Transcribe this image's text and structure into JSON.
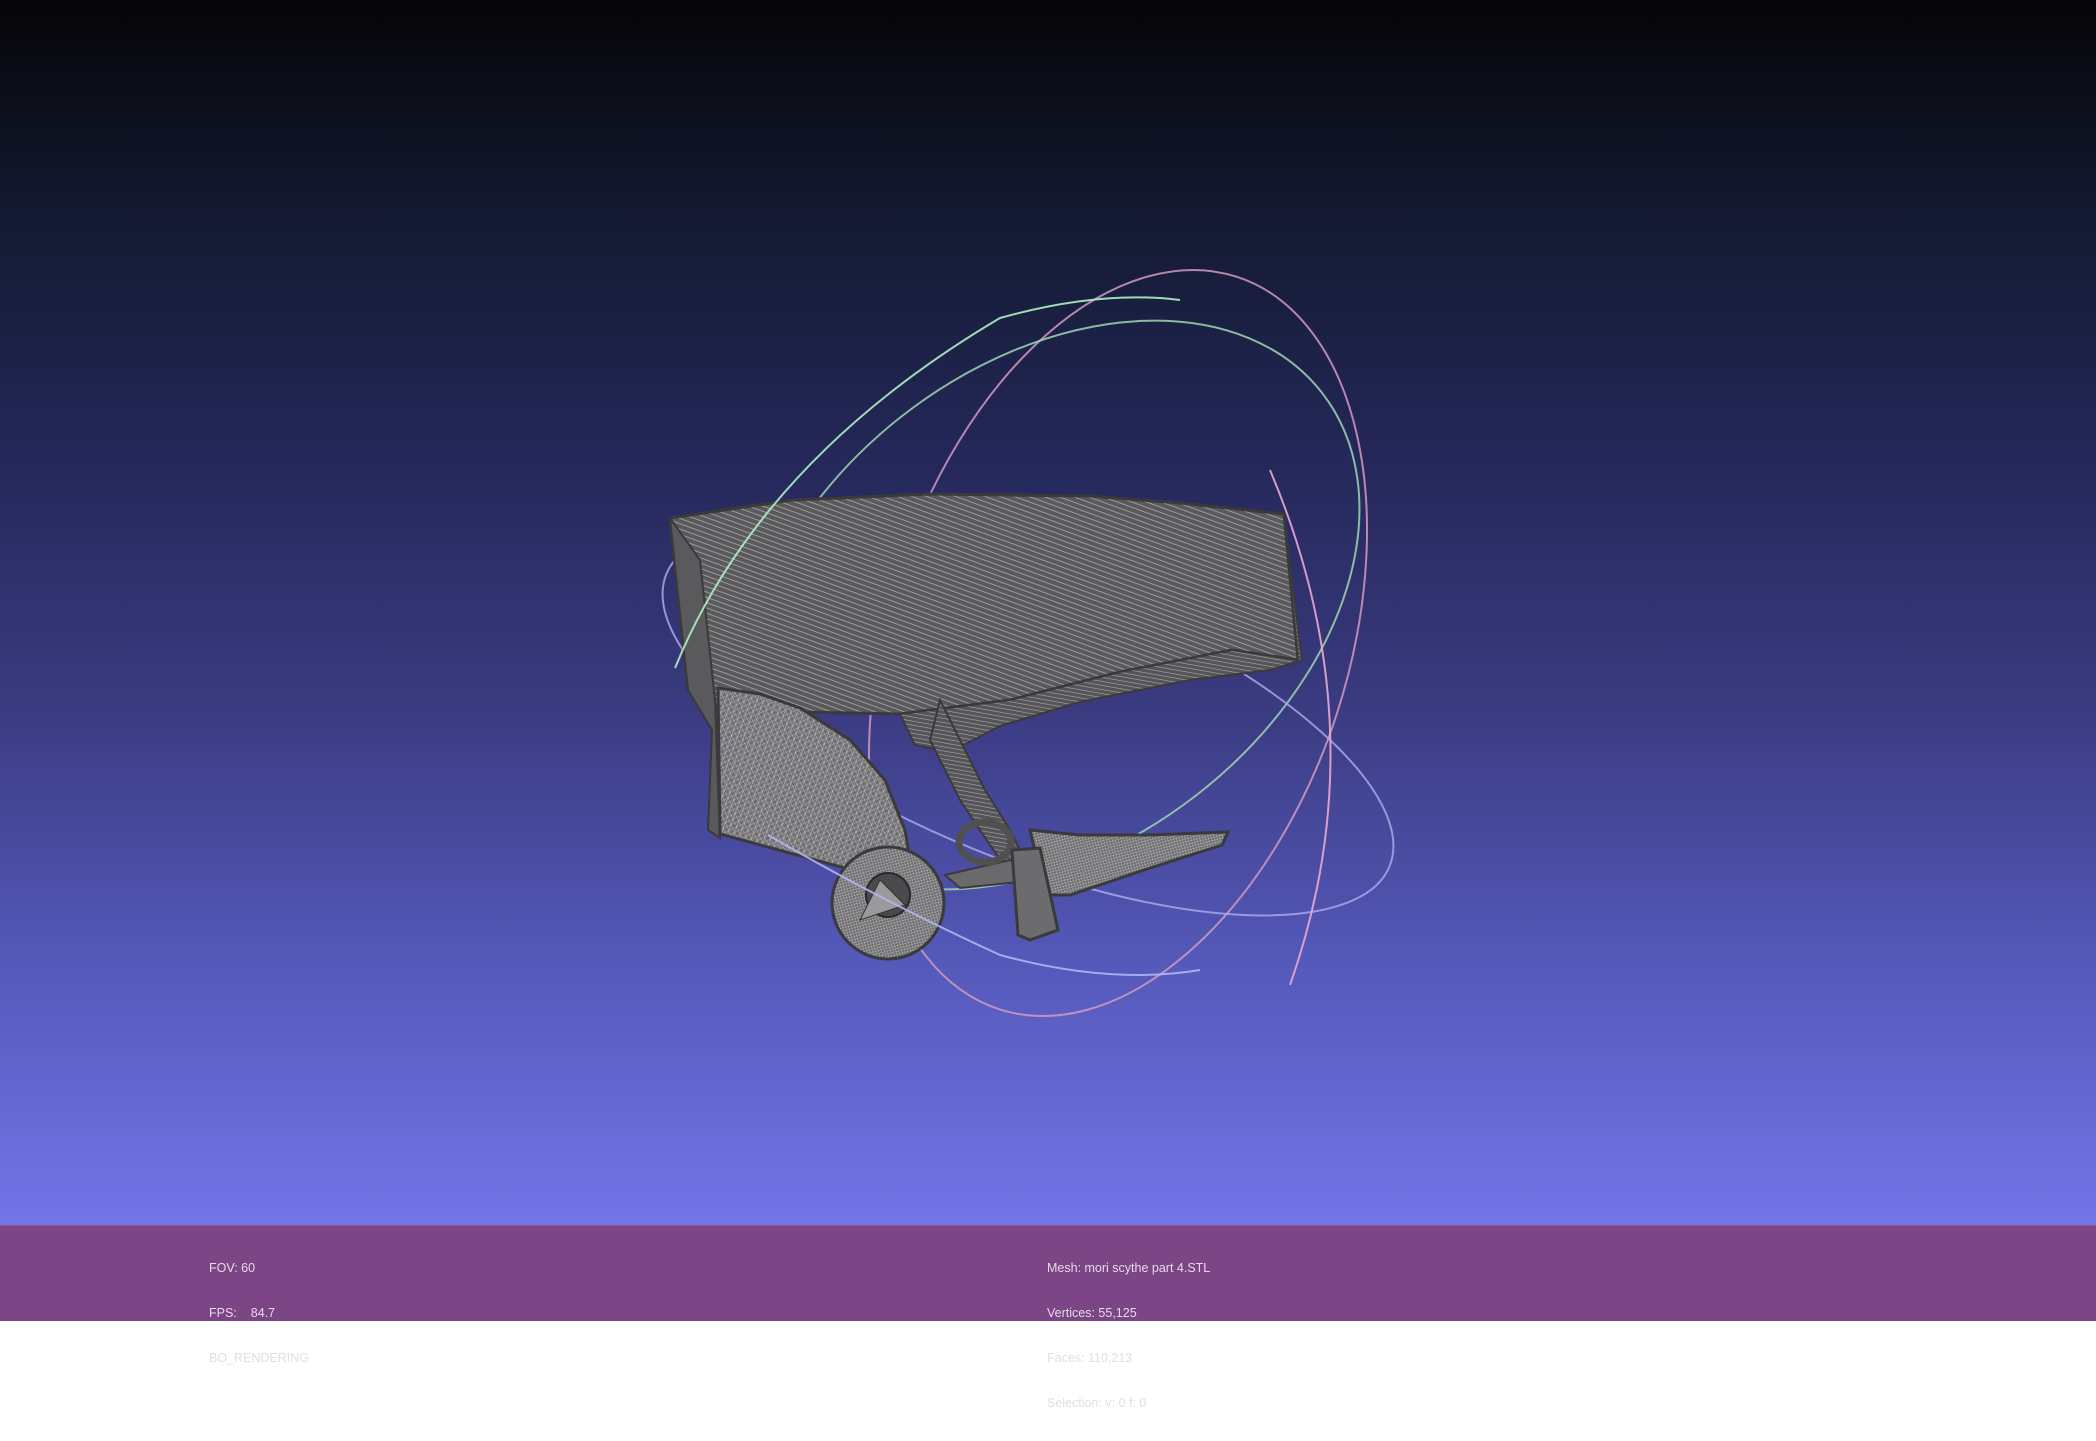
{
  "viewport": {
    "background_top": "#050507",
    "background_bottom": "#7375e8",
    "mesh_color": "#a8a8a8",
    "trackball_colors": {
      "x_axis_ring": "#e8a0c8",
      "y_axis_ring": "#a0e8b0",
      "z_axis_ring": "#a0a8f0"
    }
  },
  "status_left": {
    "fov_label": "FOV: 60",
    "fps_label": "FPS:",
    "fps_value": "84.7",
    "render_mode": "BO_RENDERING"
  },
  "status_right": {
    "mesh_name": "Mesh: mori scythe part 4.STL",
    "vertices": "Vertices: 55,125",
    "faces": "Faces: 110,213",
    "selection": "Selection: v: 0 f: 0"
  },
  "info_bar_color": "#7c4585"
}
